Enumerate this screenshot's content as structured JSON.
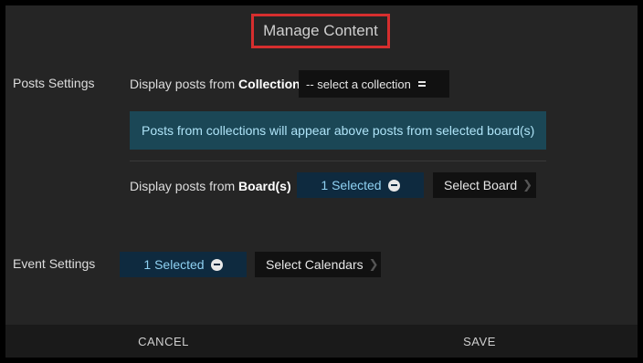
{
  "dialog": {
    "title": "Manage Content"
  },
  "posts_settings": {
    "label": "Posts Settings",
    "collection_prefix": "Display posts from",
    "collection_bold": "Collection",
    "collection_select_value": "-- select a collection",
    "info_text": "Posts from collections will appear above posts from selected board(s)",
    "boards_prefix": "Display posts from",
    "boards_bold": "Board(s)",
    "boards_selected_label": "1 Selected",
    "select_board_button": "Select Board"
  },
  "event_settings": {
    "label": "Event Settings",
    "calendars_selected_label": "1 Selected",
    "select_calendars_button": "Select Calendars"
  },
  "footer": {
    "cancel_label": "CANCEL",
    "save_label": "SAVE"
  },
  "colors": {
    "highlight_border": "#d62e2e",
    "info_banner_bg": "#1b4756",
    "info_banner_text": "#aee3f7",
    "selected_pill_bg": "#0e2a3f",
    "selected_pill_text": "#8fd1f2"
  },
  "icons": {
    "select_caret": "menu-caret-icon",
    "remove_selection": "minus-circle-icon",
    "open_picker": "chevron-right-icon"
  }
}
